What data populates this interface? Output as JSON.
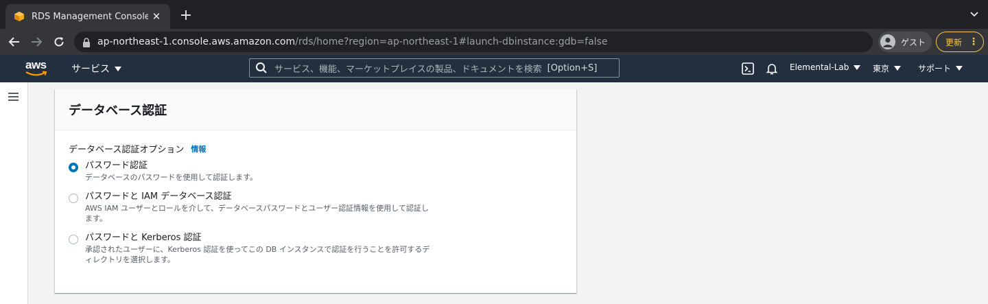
{
  "browser": {
    "tab_title": "RDS Management Console",
    "url_host": "ap-northeast-1.console.aws.amazon.com",
    "url_path": "/rds/home?region=ap-northeast-1#launch-dbinstance:gdb=false",
    "profile_label": "ゲスト",
    "update_label": "更新",
    "colors": {
      "tabbar": "#202124",
      "toolbar": "#35363a",
      "update_accent": "#f9c74f"
    }
  },
  "aws_nav": {
    "logo_text": "aws",
    "services_label": "サービス",
    "search_placeholder": "サービス、機能、マーケットプレイスの製品、ドキュメントを検索",
    "search_shortcut": "[Option+S]",
    "account_label": "Elemental-Lab",
    "region_label": "東京",
    "support_label": "サポート",
    "colors": {
      "background": "#232f3e",
      "logo_smile": "#ff9900"
    }
  },
  "panel": {
    "title": "データベース認証",
    "field_label": "データベース認証オプション",
    "info_link": "情報",
    "options": [
      {
        "title": "パスワード認証",
        "description": "データベースのパスワードを使用して認証します。",
        "selected": true
      },
      {
        "title": "パスワードと IAM データベース認証",
        "description": "AWS IAM ユーザーとロールを介して、データベースパスワードとユーザー認証情報を使用して認証します。",
        "selected": false
      },
      {
        "title": "パスワードと Kerberos 認証",
        "description": "承認されたユーザーに、Kerberos 認証を使ってこの DB インスタンスで認証を行うことを許可するディレクトリを選択します。",
        "selected": false
      }
    ],
    "colors": {
      "accent": "#0073bb"
    }
  }
}
